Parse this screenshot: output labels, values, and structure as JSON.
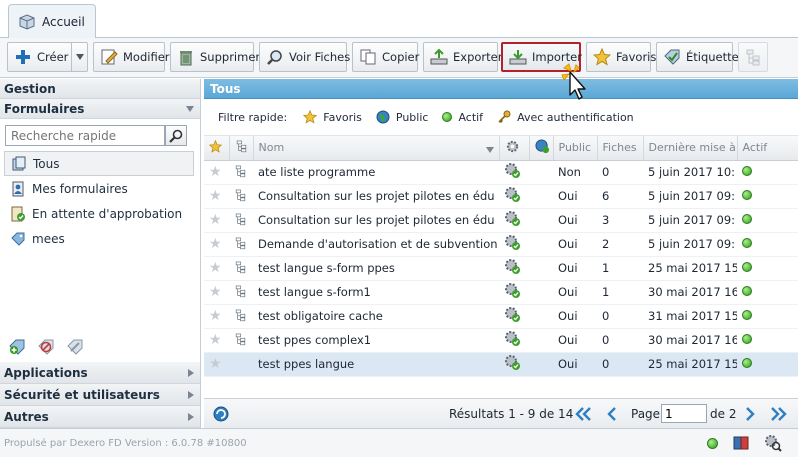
{
  "tabs": [
    {
      "label": "Accueil"
    }
  ],
  "toolbar": {
    "create": "Créer",
    "modify": "Modifier",
    "delete": "Supprimer",
    "view_forms": "Voir Fiches",
    "copy": "Copier",
    "export": "Exporter",
    "import": "Importer",
    "favorites": "Favoris",
    "label": "Étiquette"
  },
  "sidebar": {
    "gestion": "Gestion",
    "formulaires": "Formulaires",
    "search_placeholder": "Recherche rapide",
    "items": [
      {
        "label": "Tous"
      },
      {
        "label": "Mes formulaires"
      },
      {
        "label": "En attente d'approbation"
      },
      {
        "label": "mees"
      }
    ],
    "applications": "Applications",
    "security": "Sécurité et utilisateurs",
    "others": "Autres"
  },
  "main": {
    "title": "Tous",
    "quick_filter_label": "Filtre rapide:",
    "filters": [
      {
        "label": "Favoris"
      },
      {
        "label": "Public"
      },
      {
        "label": "Actif"
      },
      {
        "label": "Avec authentification"
      }
    ],
    "columns": {
      "name": "Nom",
      "public": "Public",
      "forms": "Fiches",
      "last_update": "Dernière mise à jour",
      "active": "Actif"
    },
    "rows": [
      {
        "name": "ate liste programme",
        "public": "Non",
        "forms": "0",
        "date": "5 juin 2017 10:"
      },
      {
        "name": "Consultation sur les projet pilotes en édu",
        "public": "Oui",
        "forms": "6",
        "date": "5 juin 2017 09:"
      },
      {
        "name": "Consultation sur les projet pilotes en édu",
        "public": "Oui",
        "forms": "3",
        "date": "5 juin 2017 09:"
      },
      {
        "name": "Demande d'autorisation et de subvention",
        "public": "Oui",
        "forms": "2",
        "date": "5 juin 2017 09:"
      },
      {
        "name": "test langue s-form ppes",
        "public": "Oui",
        "forms": "1",
        "date": "25 mai 2017 15"
      },
      {
        "name": "test langue s-form1",
        "public": "Oui",
        "forms": "1",
        "date": "30 mai 2017 16"
      },
      {
        "name": "test obligatoire cache",
        "public": "Oui",
        "forms": "0",
        "date": "31 mai 2017 15"
      },
      {
        "name": "test ppes complex1",
        "public": "Oui",
        "forms": "0",
        "date": "30 mai 2017 16"
      },
      {
        "name": "test ppes langue",
        "public": "Oui",
        "forms": "0",
        "date": "25 mai 2017 15"
      }
    ],
    "pager": {
      "results": "Résultats 1 - 9 de 14",
      "page_label": "Page",
      "page_value": "1",
      "of_label": "de 2"
    }
  },
  "footer": {
    "version": "Propulsé par Dexero FD Version : 6.0.78 #10800"
  }
}
